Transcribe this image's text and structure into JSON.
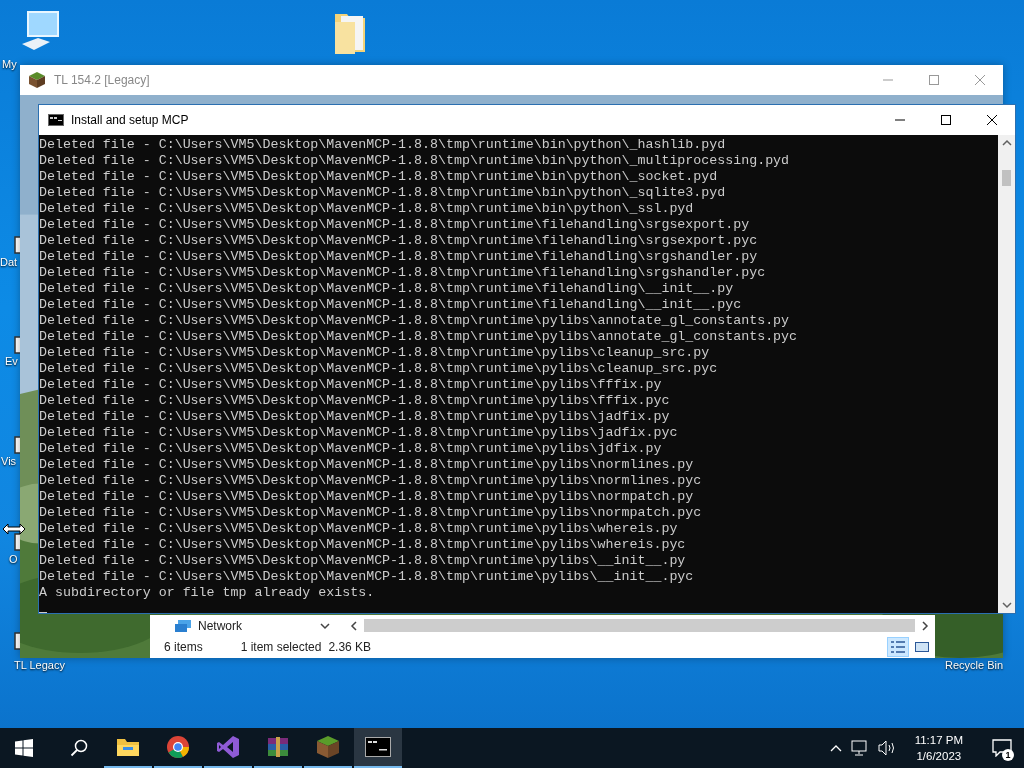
{
  "desktop_icons": [
    {
      "kind": "computer",
      "label": "My"
    },
    {
      "kind": "folder"
    },
    {
      "kind": "app",
      "label": "Dat"
    },
    {
      "kind": "app",
      "label": "Ev"
    },
    {
      "kind": "app",
      "label": "Vis"
    },
    {
      "kind": "app",
      "label": "O"
    },
    {
      "kind": "app",
      "label": "TL Legacy"
    },
    {
      "kind": "bin",
      "label": "Recycle Bin"
    }
  ],
  "background_window": {
    "title": "TL 154.2 [Legacy]"
  },
  "console": {
    "title": "Install and setup MCP",
    "lines": [
      "Deleted file - C:\\Users\\VM5\\Desktop\\MavenMCP-1.8.8\\tmp\\runtime\\bin\\python\\_hashlib.pyd",
      "Deleted file - C:\\Users\\VM5\\Desktop\\MavenMCP-1.8.8\\tmp\\runtime\\bin\\python\\_multiprocessing.pyd",
      "Deleted file - C:\\Users\\VM5\\Desktop\\MavenMCP-1.8.8\\tmp\\runtime\\bin\\python\\_socket.pyd",
      "Deleted file - C:\\Users\\VM5\\Desktop\\MavenMCP-1.8.8\\tmp\\runtime\\bin\\python\\_sqlite3.pyd",
      "Deleted file - C:\\Users\\VM5\\Desktop\\MavenMCP-1.8.8\\tmp\\runtime\\bin\\python\\_ssl.pyd",
      "Deleted file - C:\\Users\\VM5\\Desktop\\MavenMCP-1.8.8\\tmp\\runtime\\filehandling\\srgsexport.py",
      "Deleted file - C:\\Users\\VM5\\Desktop\\MavenMCP-1.8.8\\tmp\\runtime\\filehandling\\srgsexport.pyc",
      "Deleted file - C:\\Users\\VM5\\Desktop\\MavenMCP-1.8.8\\tmp\\runtime\\filehandling\\srgshandler.py",
      "Deleted file - C:\\Users\\VM5\\Desktop\\MavenMCP-1.8.8\\tmp\\runtime\\filehandling\\srgshandler.pyc",
      "Deleted file - C:\\Users\\VM5\\Desktop\\MavenMCP-1.8.8\\tmp\\runtime\\filehandling\\__init__.py",
      "Deleted file - C:\\Users\\VM5\\Desktop\\MavenMCP-1.8.8\\tmp\\runtime\\filehandling\\__init__.pyc",
      "Deleted file - C:\\Users\\VM5\\Desktop\\MavenMCP-1.8.8\\tmp\\runtime\\pylibs\\annotate_gl_constants.py",
      "Deleted file - C:\\Users\\VM5\\Desktop\\MavenMCP-1.8.8\\tmp\\runtime\\pylibs\\annotate_gl_constants.pyc",
      "Deleted file - C:\\Users\\VM5\\Desktop\\MavenMCP-1.8.8\\tmp\\runtime\\pylibs\\cleanup_src.py",
      "Deleted file - C:\\Users\\VM5\\Desktop\\MavenMCP-1.8.8\\tmp\\runtime\\pylibs\\cleanup_src.pyc",
      "Deleted file - C:\\Users\\VM5\\Desktop\\MavenMCP-1.8.8\\tmp\\runtime\\pylibs\\fffix.py",
      "Deleted file - C:\\Users\\VM5\\Desktop\\MavenMCP-1.8.8\\tmp\\runtime\\pylibs\\fffix.pyc",
      "Deleted file - C:\\Users\\VM5\\Desktop\\MavenMCP-1.8.8\\tmp\\runtime\\pylibs\\jadfix.py",
      "Deleted file - C:\\Users\\VM5\\Desktop\\MavenMCP-1.8.8\\tmp\\runtime\\pylibs\\jadfix.pyc",
      "Deleted file - C:\\Users\\VM5\\Desktop\\MavenMCP-1.8.8\\tmp\\runtime\\pylibs\\jdfix.py",
      "Deleted file - C:\\Users\\VM5\\Desktop\\MavenMCP-1.8.8\\tmp\\runtime\\pylibs\\normlines.py",
      "Deleted file - C:\\Users\\VM5\\Desktop\\MavenMCP-1.8.8\\tmp\\runtime\\pylibs\\normlines.pyc",
      "Deleted file - C:\\Users\\VM5\\Desktop\\MavenMCP-1.8.8\\tmp\\runtime\\pylibs\\normpatch.py",
      "Deleted file - C:\\Users\\VM5\\Desktop\\MavenMCP-1.8.8\\tmp\\runtime\\pylibs\\normpatch.pyc",
      "Deleted file - C:\\Users\\VM5\\Desktop\\MavenMCP-1.8.8\\tmp\\runtime\\pylibs\\whereis.py",
      "Deleted file - C:\\Users\\VM5\\Desktop\\MavenMCP-1.8.8\\tmp\\runtime\\pylibs\\whereis.pyc",
      "Deleted file - C:\\Users\\VM5\\Desktop\\MavenMCP-1.8.8\\tmp\\runtime\\pylibs\\__init__.py",
      "Deleted file - C:\\Users\\VM5\\Desktop\\MavenMCP-1.8.8\\tmp\\runtime\\pylibs\\__init__.pyc",
      "A subdirectory or file tmp already exists."
    ]
  },
  "explorer": {
    "location": "Network",
    "item_count": "6 items",
    "selection": "1 item selected",
    "size": "2.36 KB"
  },
  "taskbar": {
    "apps": [
      {
        "kind": "explorer",
        "selected": false
      },
      {
        "kind": "chrome",
        "selected": false
      },
      {
        "kind": "visualstudio",
        "selected": false
      },
      {
        "kind": "winrar",
        "selected": false
      },
      {
        "kind": "minecraft",
        "selected": false
      },
      {
        "kind": "cmd",
        "selected": true
      }
    ],
    "time": "11:17 PM",
    "date": "1/6/2023",
    "notifications": "1"
  }
}
